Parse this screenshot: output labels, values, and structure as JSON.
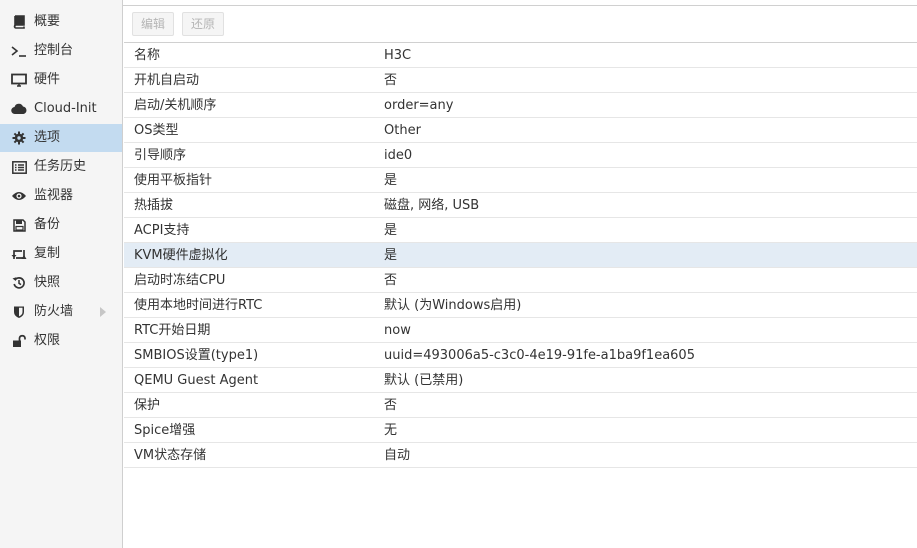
{
  "sidebar": {
    "items": [
      {
        "label": "概要",
        "icon": "book-icon"
      },
      {
        "label": "控制台",
        "icon": "terminal-icon"
      },
      {
        "label": "硬件",
        "icon": "monitor-icon"
      },
      {
        "label": "Cloud-Init",
        "icon": "cloud-icon"
      },
      {
        "label": "选项",
        "icon": "gear-icon",
        "active": true
      },
      {
        "label": "任务历史",
        "icon": "list-icon"
      },
      {
        "label": "监视器",
        "icon": "eye-icon"
      },
      {
        "label": "备份",
        "icon": "floppy-icon"
      },
      {
        "label": "复制",
        "icon": "retweet-icon"
      },
      {
        "label": "快照",
        "icon": "history-icon"
      },
      {
        "label": "防火墙",
        "icon": "shield-icon",
        "has_submenu": true
      },
      {
        "label": "权限",
        "icon": "unlock-icon"
      }
    ]
  },
  "toolbar": {
    "edit_label": "编辑",
    "revert_label": "还原"
  },
  "options": [
    {
      "key": "名称",
      "value": "H3C"
    },
    {
      "key": "开机自启动",
      "value": "否"
    },
    {
      "key": "启动/关机顺序",
      "value": "order=any"
    },
    {
      "key": "OS类型",
      "value": "Other"
    },
    {
      "key": "引导顺序",
      "value": "ide0"
    },
    {
      "key": "使用平板指针",
      "value": "是"
    },
    {
      "key": "热插拔",
      "value": "磁盘, 网络, USB"
    },
    {
      "key": "ACPI支持",
      "value": "是"
    },
    {
      "key": "KVM硬件虚拟化",
      "value": "是",
      "selected": true
    },
    {
      "key": "启动时冻结CPU",
      "value": "否"
    },
    {
      "key": "使用本地时间进行RTC",
      "value": "默认 (为Windows启用)"
    },
    {
      "key": "RTC开始日期",
      "value": "now"
    },
    {
      "key": "SMBIOS设置(type1)",
      "value": "uuid=493006a5-c3c0-4e19-91fe-a1ba9f1ea605"
    },
    {
      "key": "QEMU Guest Agent",
      "value": "默认 (已禁用)"
    },
    {
      "key": "保护",
      "value": "否"
    },
    {
      "key": "Spice增强",
      "value": "无"
    },
    {
      "key": "VM状态存储",
      "value": "自动"
    }
  ],
  "colors": {
    "sidebar_bg": "#f5f5f5",
    "active_item_bg": "#c3dbf0",
    "selected_row_bg": "#e3ecf5",
    "text": "#333333",
    "disabled_text": "#b5b5b5"
  }
}
